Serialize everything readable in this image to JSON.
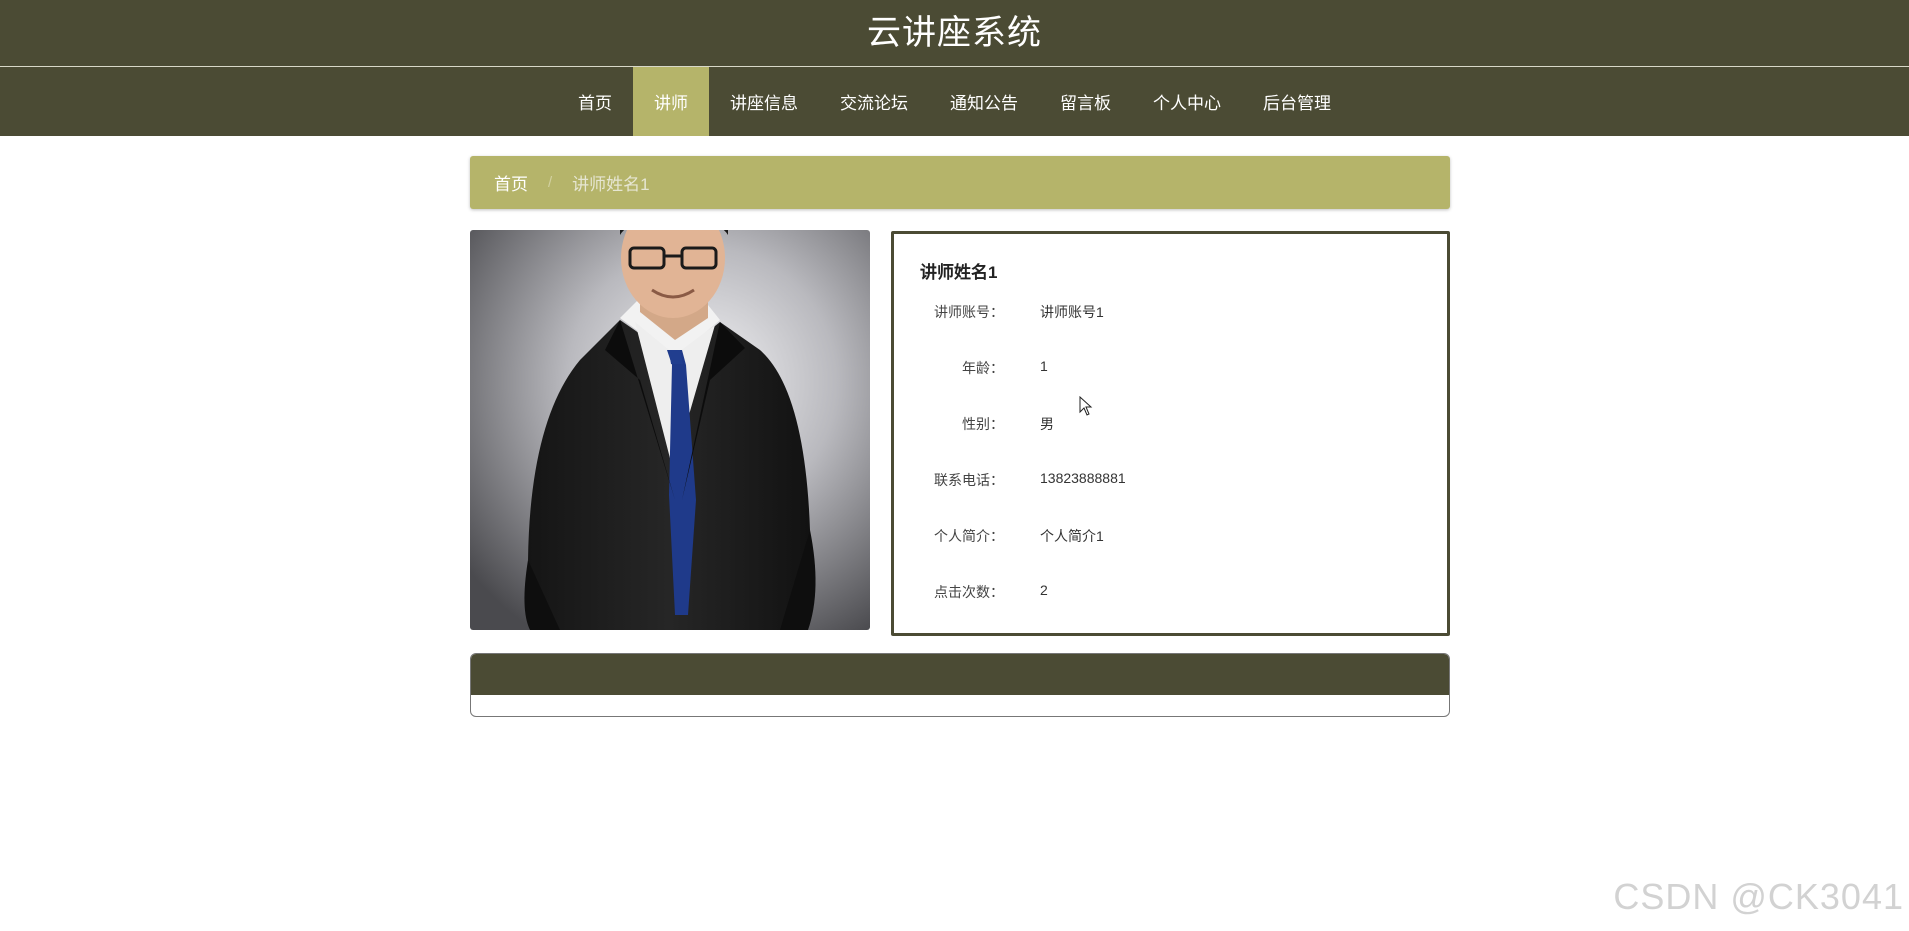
{
  "site": {
    "title": "云讲座系统"
  },
  "nav": {
    "items": [
      {
        "label": "首页"
      },
      {
        "label": "讲师"
      },
      {
        "label": "讲座信息"
      },
      {
        "label": "交流论坛"
      },
      {
        "label": "通知公告"
      },
      {
        "label": "留言板"
      },
      {
        "label": "个人中心"
      },
      {
        "label": "后台管理"
      }
    ],
    "active": "讲师"
  },
  "breadcrumb": {
    "home": "首页",
    "separator": "/",
    "current": "讲师姓名1"
  },
  "teacher": {
    "name": "讲师姓名1",
    "fields": [
      {
        "label": "讲师账号：",
        "value": "讲师账号1"
      },
      {
        "label": "年龄：",
        "value": "1"
      },
      {
        "label": "性别：",
        "value": "男"
      },
      {
        "label": "联系电话：",
        "value": "13823888881"
      },
      {
        "label": "个人简介：",
        "value": "个人简介1"
      },
      {
        "label": "点击次数：",
        "value": "2"
      }
    ]
  },
  "watermark": "CSDN @CK3041",
  "colors": {
    "header": "#4b4b34",
    "accent": "#b5b46a"
  }
}
